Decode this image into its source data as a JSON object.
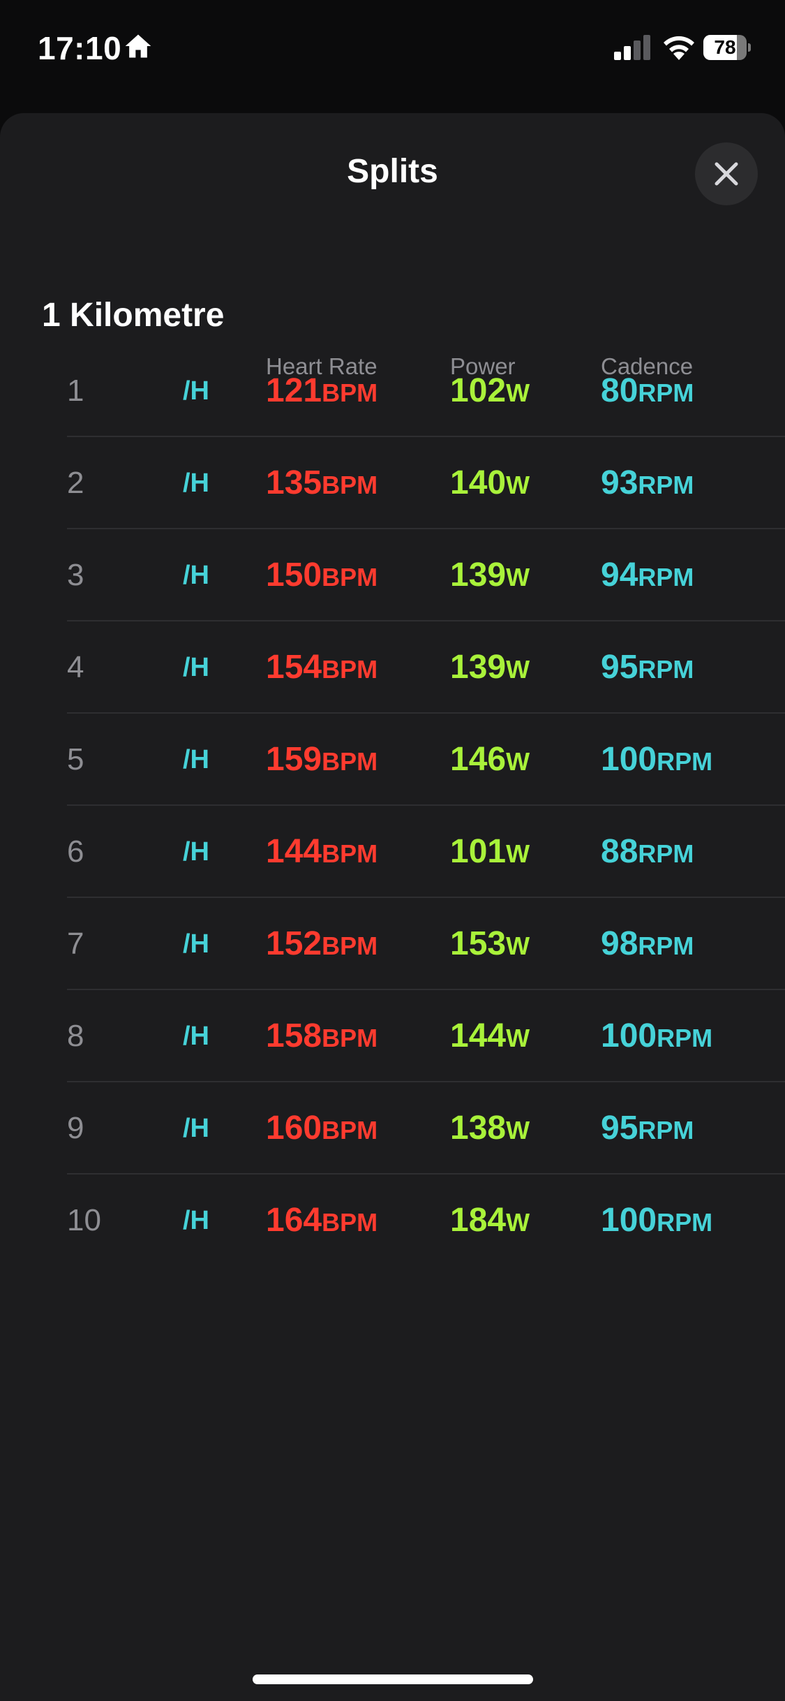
{
  "status_bar": {
    "time": "17:10",
    "battery_level": "78",
    "battery_fraction": 0.78,
    "icons": [
      "home-icon",
      "signal-icon",
      "wifi-icon",
      "battery-icon"
    ]
  },
  "sheet": {
    "title": "Splits",
    "close_icon": "close-icon"
  },
  "section": {
    "title": "1 Kilometre"
  },
  "columns": {
    "heart_rate": "Heart Rate",
    "power": "Power",
    "cadence": "Cadence"
  },
  "colors": {
    "heart_rate": "#ff3b2f",
    "power": "#a9f23a",
    "cadence": "#46d2d8",
    "background": "#1c1c1e"
  },
  "rows": [
    {
      "split": "1",
      "speed_fragment": "/H",
      "heart_rate": "121",
      "heart_unit": "BPM",
      "power": "102",
      "power_unit": "W",
      "cadence": "80",
      "cadence_unit": "RPM"
    },
    {
      "split": "2",
      "speed_fragment": "/H",
      "heart_rate": "135",
      "heart_unit": "BPM",
      "power": "140",
      "power_unit": "W",
      "cadence": "93",
      "cadence_unit": "RPM"
    },
    {
      "split": "3",
      "speed_fragment": "/H",
      "heart_rate": "150",
      "heart_unit": "BPM",
      "power": "139",
      "power_unit": "W",
      "cadence": "94",
      "cadence_unit": "RPM"
    },
    {
      "split": "4",
      "speed_fragment": "/H",
      "heart_rate": "154",
      "heart_unit": "BPM",
      "power": "139",
      "power_unit": "W",
      "cadence": "95",
      "cadence_unit": "RPM"
    },
    {
      "split": "5",
      "speed_fragment": "/H",
      "heart_rate": "159",
      "heart_unit": "BPM",
      "power": "146",
      "power_unit": "W",
      "cadence": "100",
      "cadence_unit": "RPM"
    },
    {
      "split": "6",
      "speed_fragment": "/H",
      "heart_rate": "144",
      "heart_unit": "BPM",
      "power": "101",
      "power_unit": "W",
      "cadence": "88",
      "cadence_unit": "RPM"
    },
    {
      "split": "7",
      "speed_fragment": "/H",
      "heart_rate": "152",
      "heart_unit": "BPM",
      "power": "153",
      "power_unit": "W",
      "cadence": "98",
      "cadence_unit": "RPM"
    },
    {
      "split": "8",
      "speed_fragment": "/H",
      "heart_rate": "158",
      "heart_unit": "BPM",
      "power": "144",
      "power_unit": "W",
      "cadence": "100",
      "cadence_unit": "RPM"
    },
    {
      "split": "9",
      "speed_fragment": "/H",
      "heart_rate": "160",
      "heart_unit": "BPM",
      "power": "138",
      "power_unit": "W",
      "cadence": "95",
      "cadence_unit": "RPM"
    },
    {
      "split": "10",
      "speed_fragment": "/H",
      "heart_rate": "164",
      "heart_unit": "BPM",
      "power": "184",
      "power_unit": "W",
      "cadence": "100",
      "cadence_unit": "RPM"
    }
  ]
}
